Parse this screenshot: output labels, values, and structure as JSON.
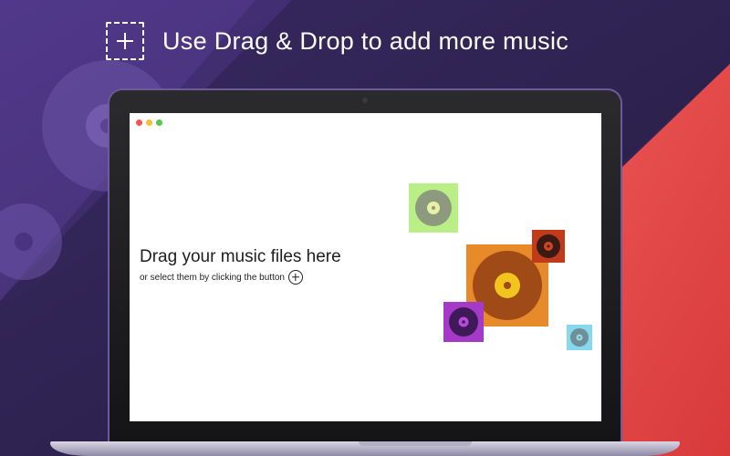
{
  "banner": {
    "headline": "Use Drag & Drop to add more music",
    "icon": "dashed-plus-icon"
  },
  "window": {
    "traffic_lights": [
      "#ee5a52",
      "#f4bd3a",
      "#5cc44c"
    ]
  },
  "drop_zone": {
    "title": "Drag your music files here",
    "subtitle": "or select them by clicking the button",
    "add_icon": "plus-circle-icon"
  },
  "colors": {
    "background_purple": "#2a1e4a",
    "background_red": "#e84a4a",
    "record_green": "#b9ef86",
    "record_orange": "#e78a2a",
    "record_red": "#c13a1a",
    "record_purple": "#a63ac8",
    "record_cyan": "#86d8ef"
  }
}
